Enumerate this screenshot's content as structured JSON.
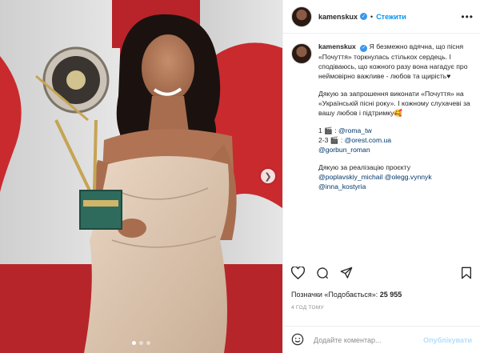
{
  "post": {
    "username": "kamenskux",
    "follow_label": "Стежити",
    "separator": "•",
    "caption": {
      "intro": "Я безмежно вдячна, що пісня «Почуття» торкнулась стількох сердець. І сподіваюсь, що кожного разу вона нагадує про неймовірно важливе - любов та щирість♥",
      "thanks": "Дякую за запрошення виконати «Почуття» на «Українській пісні року». І кожному слухачеві за вашу любов і підтримку🥰",
      "credit1_prefix": "1 🎬 : ",
      "credit1_mention": "@roma_tw",
      "credit2_prefix": "2-3 🎬 : ",
      "credit2_mention": "@orest.com.ua",
      "credit3_mention": "@gorbun_roman",
      "realization_text": "Дякую за реалізацію проєкту",
      "realization_mention1": "@poplavskiy_michail",
      "realization_mention2": "@olegg.vynnyk",
      "realization_mention3": "@inna_kostyria"
    },
    "likes_prefix": "Позначки «Подобається»: ",
    "likes_count": "25 955",
    "time_ago": "4 ГОД ТОМУ",
    "comment_placeholder": "Додайте коментар...",
    "publish_label": "Опублікувати",
    "carousel_total": 3,
    "carousel_active": 1
  },
  "icons": {
    "verified": "verified-badge-icon",
    "more": "more-options-icon",
    "like": "heart-icon",
    "comment": "comment-icon",
    "share": "share-icon",
    "save": "bookmark-icon",
    "emoji": "emoji-icon",
    "next": "chevron-right-icon"
  },
  "colors": {
    "accent": "#0095f6",
    "mention": "#00376b",
    "verified": "#3897f0",
    "photo_background": "#c92a2e"
  }
}
